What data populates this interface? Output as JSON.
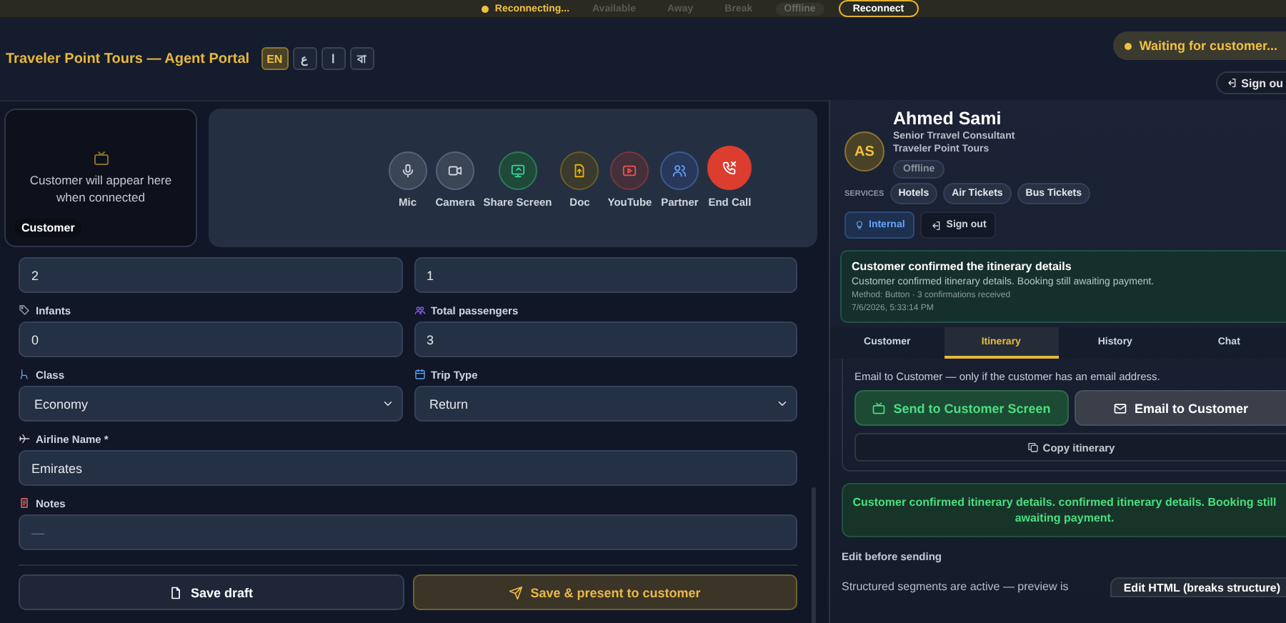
{
  "status_bar": {
    "connection": "Reconnecting...",
    "statuses": [
      {
        "label": "Available",
        "selected": false
      },
      {
        "label": "Away",
        "selected": false
      },
      {
        "label": "Break",
        "selected": false
      },
      {
        "label": "Offline",
        "selected": true
      }
    ],
    "reconnect_button": "Reconnect"
  },
  "header": {
    "title": "Traveler Point Tours — Agent Portal",
    "languages": [
      {
        "label": "EN",
        "selected": true
      },
      {
        "label": "ع",
        "selected": false
      },
      {
        "label": "ا",
        "selected": false
      },
      {
        "label": "বা",
        "selected": false
      }
    ],
    "waiting_badge": "Waiting for customer...",
    "sign_out": "Sign ou"
  },
  "video": {
    "placeholder": "Customer will appear here when connected",
    "label": "Customer"
  },
  "call_controls": [
    {
      "label": "Mic",
      "kind": "mic"
    },
    {
      "label": "Camera",
      "kind": "camera"
    },
    {
      "label": "Share Screen",
      "kind": "share"
    },
    {
      "label": "Doc",
      "kind": "doc"
    },
    {
      "label": "YouTube",
      "kind": "youtube"
    },
    {
      "label": "Partner",
      "kind": "partner"
    },
    {
      "label": "End Call",
      "kind": "end"
    }
  ],
  "form": {
    "fields": [
      {
        "kind": "input",
        "value": "2"
      },
      {
        "kind": "input",
        "value": "1"
      },
      {
        "kind": "input",
        "label": "Infants",
        "value": "0"
      },
      {
        "kind": "input",
        "label": "Total passengers",
        "value": "3"
      },
      {
        "kind": "select",
        "label": "Class",
        "value": "Economy"
      },
      {
        "kind": "select",
        "label": "Trip Type",
        "value": "Return"
      },
      {
        "kind": "input",
        "label": "Airline Name *",
        "value": "Emirates"
      },
      {
        "kind": "input",
        "label": "Notes",
        "placeholder": "—"
      }
    ],
    "save_draft": "Save draft",
    "save_present": "Save & present to customer"
  },
  "agent": {
    "initials": "AS",
    "name": "Ahmed Sami",
    "title": "Senior Trravel Consultant",
    "company": "Traveler Point Tours",
    "status": "Offline",
    "services_label": "SERVICES",
    "services": [
      "Hotels",
      "Air Tickets",
      "Bus Tickets"
    ],
    "internal_button": "Internal",
    "sign_out": "Sign out"
  },
  "notification": {
    "title": "Customer confirmed the itinerary details",
    "message": "Customer confirmed itinerary details. Booking still awaiting payment.",
    "meta": "Method: Button · 3 confirmations received",
    "time": "7/6/2026, 5:33:14 PM"
  },
  "tabs": [
    {
      "label": "Customer",
      "selected": false
    },
    {
      "label": "Itinerary",
      "selected": true
    },
    {
      "label": "History",
      "selected": false
    },
    {
      "label": "Chat",
      "selected": false
    }
  ],
  "itinerary": {
    "email_hint": "Email to Customer — only if the customer has an email address.",
    "send_screen": "Send to Customer Screen",
    "email_button": "Email to Customer",
    "copy_button": "Copy itinerary",
    "confirmation": "Customer confirmed itinerary details. confirmed itinerary details. Booking still awaiting payment.",
    "edit_heading": "Edit before sending",
    "structured_note": "Structured segments are active — preview is",
    "edit_html_button": "Edit HTML (breaks structure)"
  }
}
